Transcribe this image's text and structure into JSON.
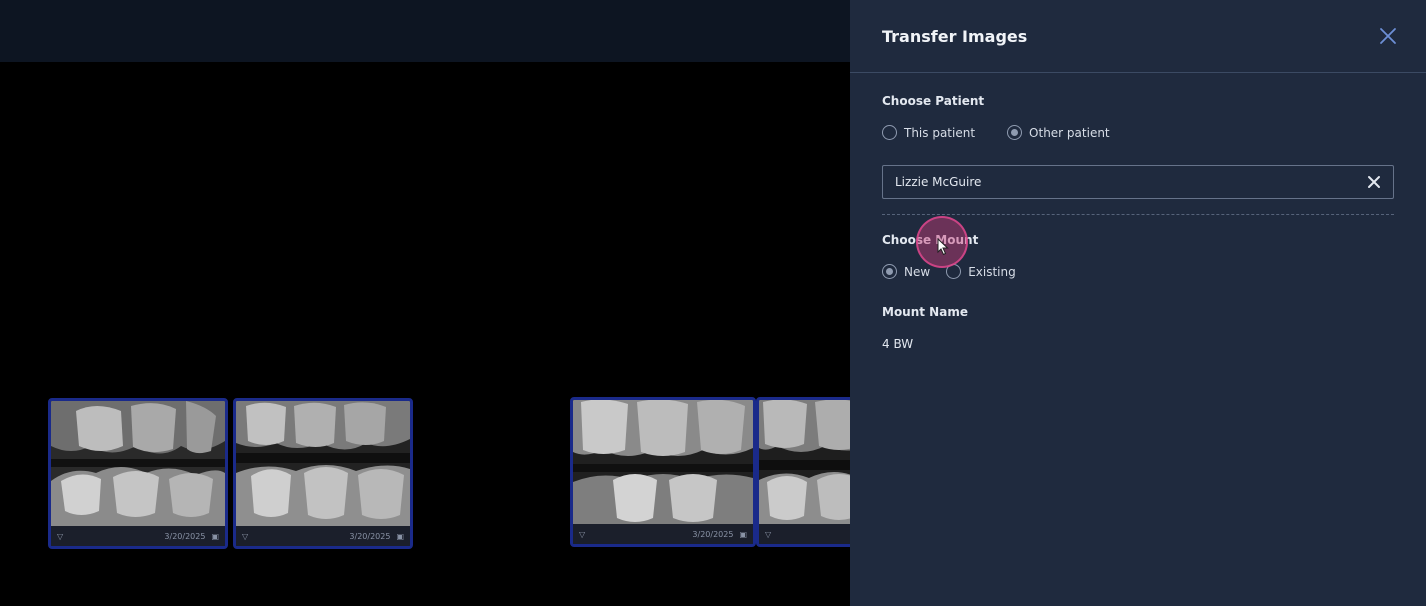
{
  "panel": {
    "title": "Transfer Images",
    "close_icon": "close-icon",
    "choose_patient": {
      "label": "Choose Patient",
      "options": [
        "This patient",
        "Other patient"
      ],
      "selected": "Other patient"
    },
    "patient_field": {
      "value": "Lizzie McGuire",
      "clear_icon": "clear-icon"
    },
    "choose_mount": {
      "label": "Choose Mount",
      "options": [
        "New",
        "Existing"
      ],
      "selected": "New"
    },
    "mount_name": {
      "label": "Mount Name",
      "value": "4 BW"
    }
  },
  "thumbnails": [
    {
      "date": "3/20/2025",
      "tooth_icon": "tooth-icon",
      "mount_icon": "image-icon"
    },
    {
      "date": "3/20/2025",
      "tooth_icon": "tooth-icon",
      "mount_icon": "image-icon"
    },
    {
      "date": "3/20/2025",
      "tooth_icon": "tooth-icon",
      "mount_icon": "image-icon"
    },
    {
      "date": "",
      "tooth_icon": "tooth-icon",
      "mount_icon": ""
    }
  ],
  "colors": {
    "panel_bg": "#1f2a3e",
    "topbar_bg": "#0d1522",
    "thumb_border": "#1a2a8a",
    "close_accent": "#6d8fd6"
  }
}
